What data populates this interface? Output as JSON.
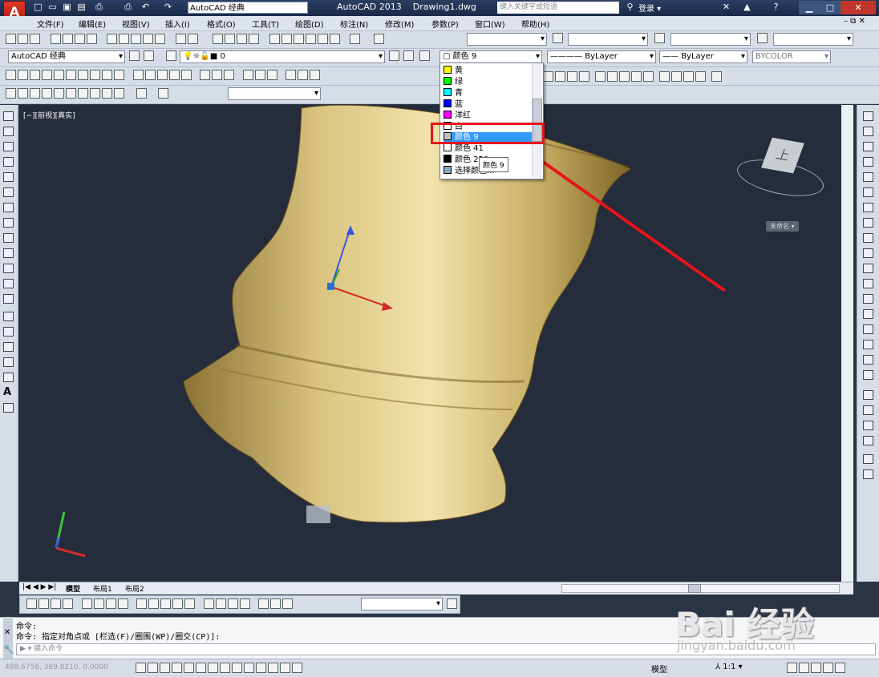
{
  "title_bar": {
    "workspace": "AutoCAD 经典",
    "app_name": "AutoCAD 2013",
    "file_name": "Drawing1.dwg",
    "search_placeholder": "键入关键字或短语",
    "login": "登录"
  },
  "menu": [
    "文件(F)",
    "编辑(E)",
    "视图(V)",
    "插入(I)",
    "格式(O)",
    "工具(T)",
    "绘图(D)",
    "标注(N)",
    "修改(M)",
    "参数(P)",
    "窗口(W)",
    "帮助(H)"
  ],
  "layer_toolbar": {
    "workspace_combo": "AutoCAD 经典",
    "layer_value": "0",
    "color_value": "颜色 9",
    "linetype_value": "ByLayer",
    "lineweight_value": "ByLayer",
    "plotstyle_value": "BYCOLOR"
  },
  "viewport": {
    "label": "[−][前视][真实]",
    "viewcube_face": "上",
    "unnamed_label": "未命名"
  },
  "color_dropdown": {
    "items": [
      {
        "label": "黄",
        "color": "#ffff00"
      },
      {
        "label": "绿",
        "color": "#00ff00"
      },
      {
        "label": "青",
        "color": "#00ffff"
      },
      {
        "label": "蓝",
        "color": "#0000ff"
      },
      {
        "label": "洋红",
        "color": "#ff00ff"
      },
      {
        "label": "白",
        "color": "#ffffff"
      },
      {
        "label": "颜色 9",
        "color": "#c0c0c0",
        "selected": true
      },
      {
        "label": "颜色 41",
        "color": "#ffffff"
      },
      {
        "label": "颜色 250",
        "color": "#000000"
      },
      {
        "label": "选择颜色...",
        "color": "#8ab"
      }
    ],
    "tooltip": "颜色 9"
  },
  "tabs": [
    "模型",
    "布局1",
    "布局2"
  ],
  "command": {
    "line1": "命令:",
    "line2": "命令: 指定对角点或 [栏选(F)/圈围(WP)/圈交(CP)]:",
    "input_placeholder": "键入命令"
  },
  "status": {
    "coords": "488.6756, 389.8210, 0.0000",
    "model": "模型",
    "scale": "1:1"
  },
  "watermark": {
    "brand": "Bai 经验",
    "url": "jingyan.baidu.com"
  },
  "colors": {
    "annotation_red": "#e8141a",
    "object_gold": "#c9b06a"
  }
}
